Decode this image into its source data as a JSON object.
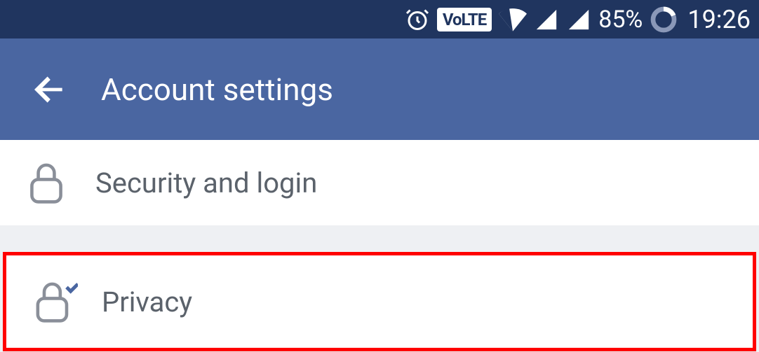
{
  "status_bar": {
    "battery_pct": "85%",
    "clock": "19:26",
    "volte_label": "VoLTE"
  },
  "app_bar": {
    "title": "Account settings"
  },
  "items": [
    {
      "label": "Security and login"
    },
    {
      "label": "Privacy"
    }
  ]
}
